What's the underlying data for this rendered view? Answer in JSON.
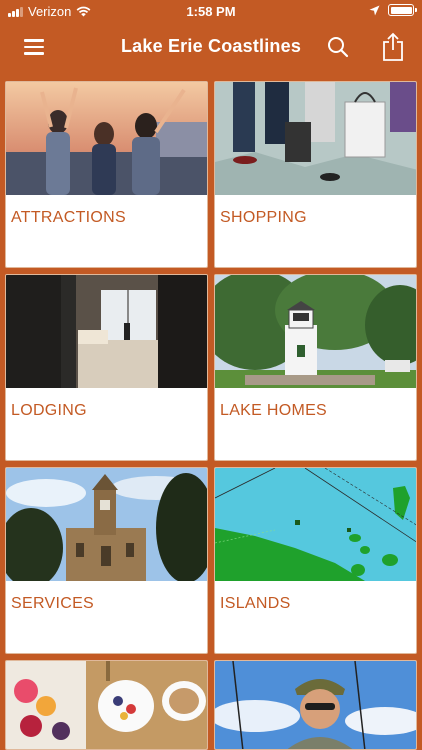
{
  "status_bar": {
    "carrier": "Verizon",
    "time": "1:58 PM"
  },
  "nav": {
    "title": "Lake Erie Coastlines",
    "menu_icon": "hamburger-menu-icon",
    "search_icon": "search-icon",
    "share_icon": "share-icon"
  },
  "tiles": [
    {
      "label": "ATTRACTIONS"
    },
    {
      "label": "SHOPPING"
    },
    {
      "label": "LODGING"
    },
    {
      "label": "LAKE HOMES"
    },
    {
      "label": "SERVICES"
    },
    {
      "label": "ISLANDS"
    }
  ],
  "colors": {
    "brand": "#c35a24",
    "tile_bg": "#ffffff"
  }
}
